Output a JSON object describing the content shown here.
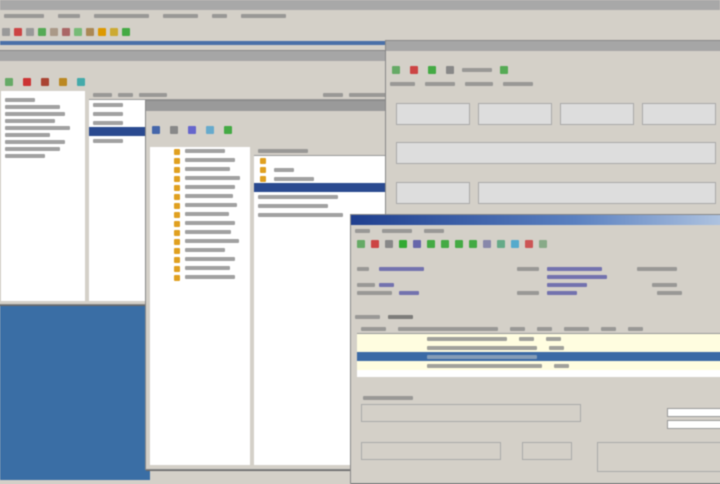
{
  "colors": {
    "desktop": "#3a6ea5",
    "selection": "#3b6aa5",
    "active_title": "#1f3f8f",
    "row_highlight": "#fffde0"
  },
  "main_toolbar_icons": [
    "doc-icon",
    "delete-icon",
    "doc-icon",
    "add-icon",
    "doc-icon",
    "folder-icon",
    "doc-icon",
    "print-icon",
    "folder-icon",
    "folder-icon",
    "ok-icon"
  ],
  "document_table": {
    "rows": 5,
    "selected_row": 3
  },
  "tree_list": {
    "selected_row": 4
  }
}
